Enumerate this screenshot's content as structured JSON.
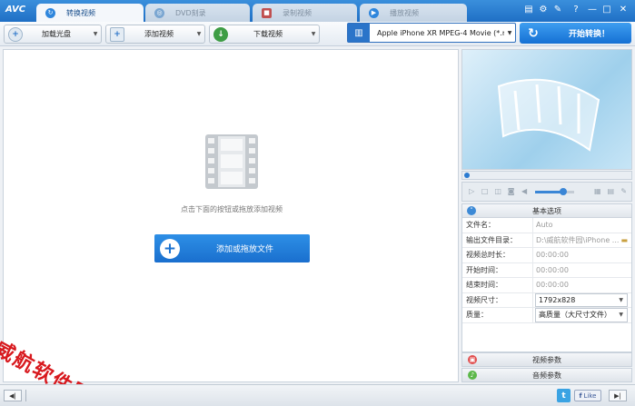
{
  "app": {
    "logo": "AVC"
  },
  "tabs": [
    {
      "label": "转换视频",
      "icon": "convert-icon",
      "active": true
    },
    {
      "label": "DVD刻录",
      "icon": "disc-icon",
      "active": false
    },
    {
      "label": "录制视频",
      "icon": "record-icon",
      "active": false
    },
    {
      "label": "播放视频",
      "icon": "play-icon",
      "active": false
    }
  ],
  "window_controls": {
    "skin": "▤",
    "settings": "⚙",
    "tools": "✎",
    "help": "?",
    "minimize": "—",
    "maximize": "□",
    "close": "✕"
  },
  "toolbar": {
    "load_disc": "加载光盘",
    "add_video": "添加视频",
    "download_video": "下载视频",
    "profile_value": "Apple iPhone XR MPEG-4 Movie (*.m...",
    "convert_label": "开始转换！"
  },
  "main": {
    "hint": "点击下面的按钮或拖放添加视频",
    "add_button": "添加或拖放文件",
    "watermark": "威航软件园"
  },
  "settings": {
    "section_title": "基本选项",
    "rows": [
      {
        "label": "文件名：",
        "value": "Auto"
      },
      {
        "label": "输出文件目录：",
        "value": "D:\\威航软件园\\iPhone ..."
      },
      {
        "label": "视频总时长：",
        "value": "00:00:00"
      },
      {
        "label": "开始时间：",
        "value": "00:00:00"
      },
      {
        "label": "结束时间：",
        "value": "00:00:00"
      },
      {
        "label": "视频尺寸：",
        "value": "1792x828"
      },
      {
        "label": "质量：",
        "value": "高质量（大尺寸文件）"
      }
    ],
    "video_params": "视频参数",
    "audio_params": "音频参数"
  },
  "player": {
    "volume": 0.7,
    "seek_position": 0.0
  },
  "statusbar": {
    "left_btn": "◀|",
    "like_label": "Like",
    "right_btn": "▶|",
    "twitter": "t"
  },
  "colors": {
    "accent": "#1f6fc5",
    "convert": "#1570d4",
    "watermark": "#d8191e"
  }
}
